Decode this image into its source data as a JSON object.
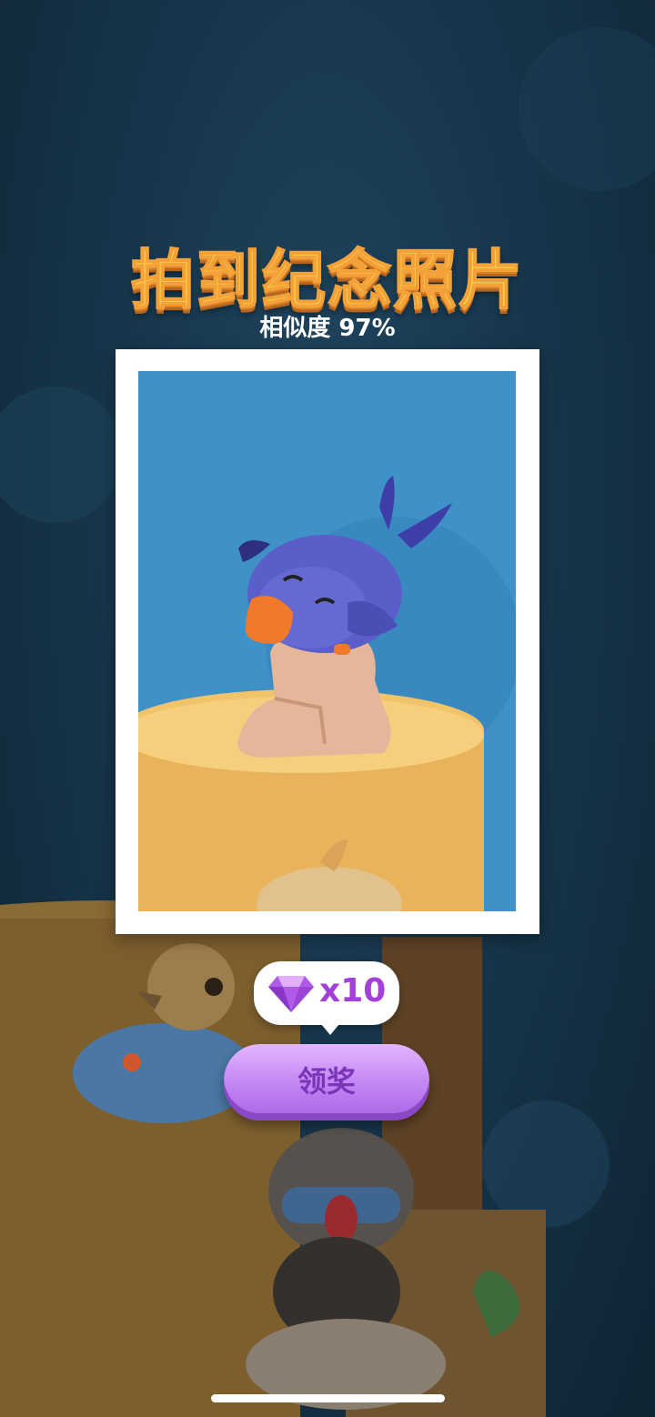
{
  "title": "拍到纪念照片",
  "similarity_text": "相似度 97%",
  "reward": {
    "icon": "purple-gem-icon",
    "count_label": "x10"
  },
  "claim_button_label": "领奖",
  "colors": {
    "title": "#ffd24a",
    "button": "#c78bf5",
    "photo_background": "#3d8fc6"
  }
}
